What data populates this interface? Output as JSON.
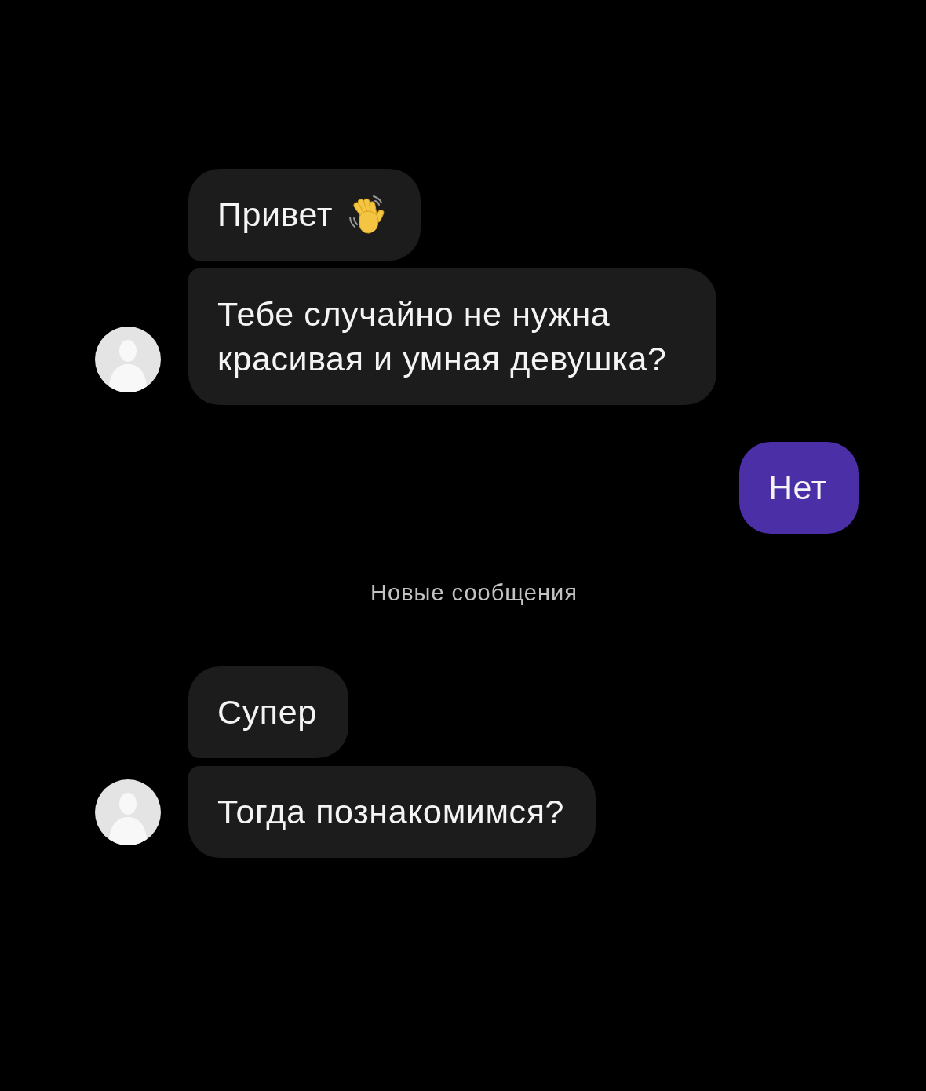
{
  "chat": [
    {
      "kind": "incoming",
      "messages": [
        {
          "text": "Привет",
          "emoji": true
        },
        {
          "text": "Тебе случайно не нужна красивая и умная девушка?",
          "emoji": false
        }
      ]
    },
    {
      "kind": "outgoing",
      "messages": [
        {
          "text": "Нет",
          "emoji": false
        }
      ]
    },
    {
      "kind": "divider",
      "label": "Новые сообщения"
    },
    {
      "kind": "incoming",
      "messages": [
        {
          "text": "Супер",
          "emoji": false
        },
        {
          "text": "Тогда познакомимся?",
          "emoji": false
        }
      ]
    }
  ]
}
